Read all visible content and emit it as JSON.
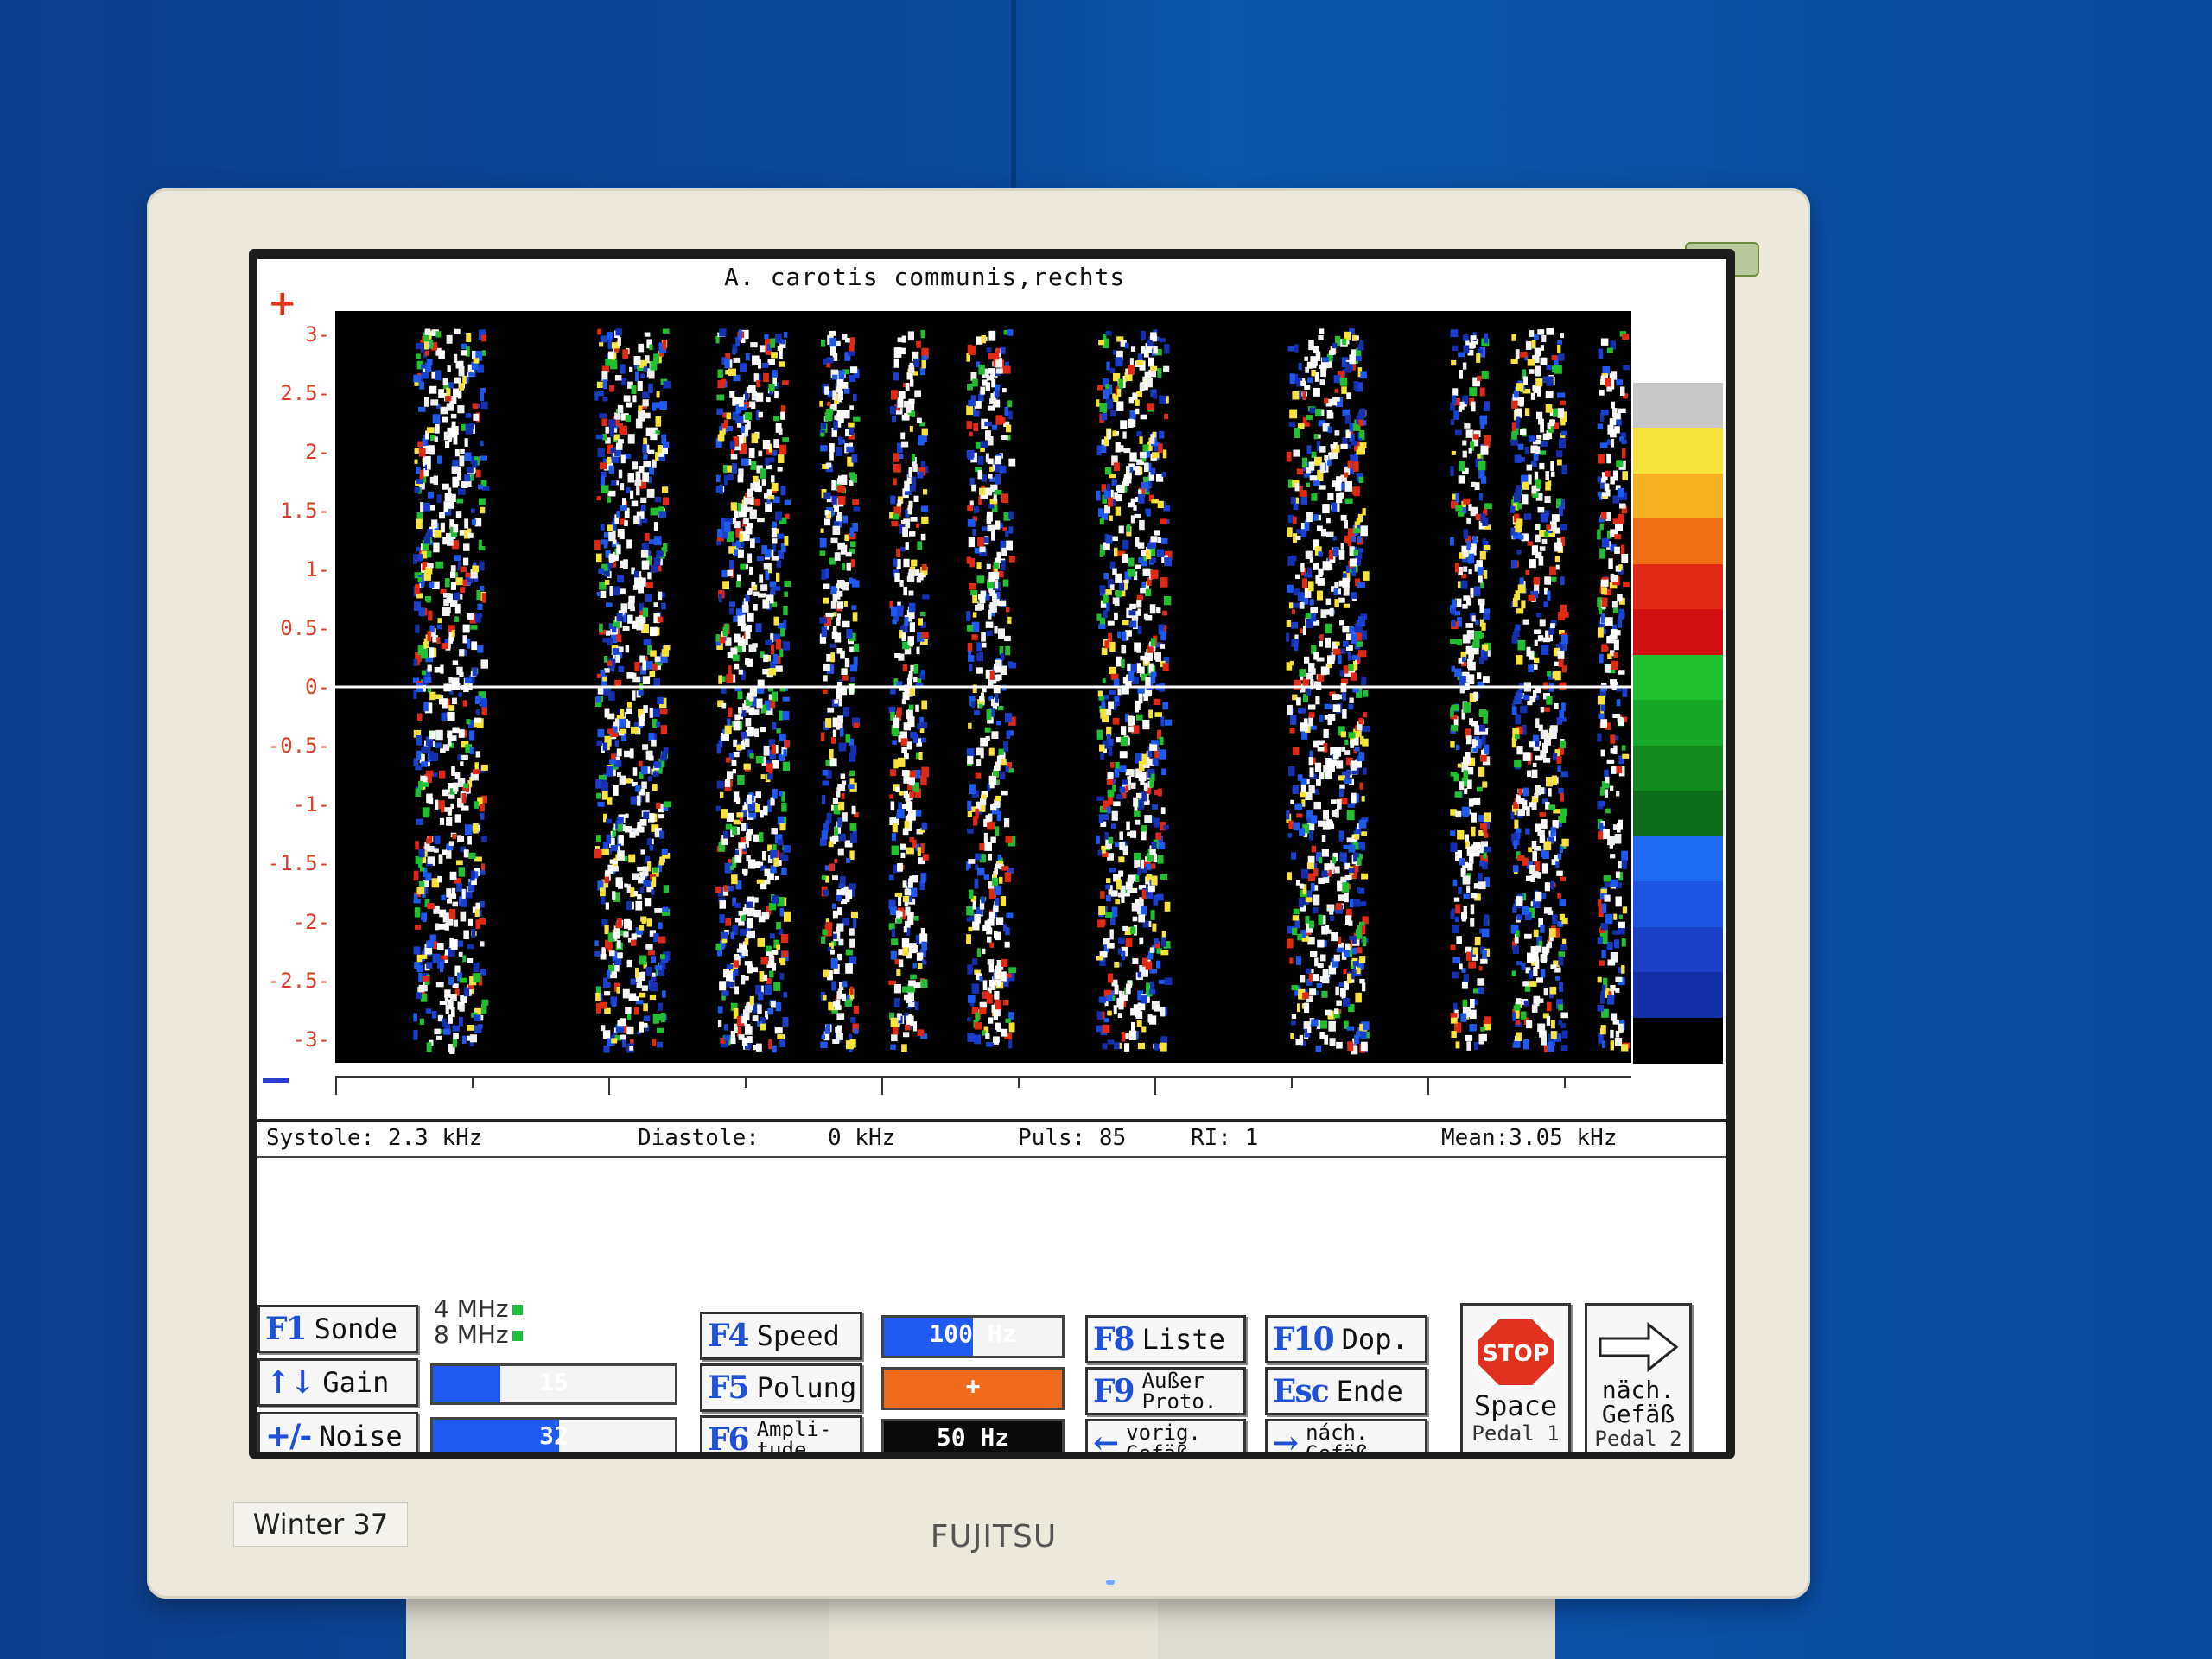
{
  "plot": {
    "title": "A. carotis communis,rechts",
    "plus_sign": "+",
    "y_ticks": [
      "3",
      "2.5",
      "2",
      "1.5",
      "1",
      "0.5",
      "0",
      "-0.5",
      "-1",
      "-1.5",
      "-2",
      "-2.5",
      "-3"
    ],
    "y_range": [
      -3.2,
      3.2
    ],
    "color_scale": [
      "#ffffff",
      "#c8c8c8",
      "#f7e33b",
      "#f5b022",
      "#f06e14",
      "#e02a14",
      "#d01010",
      "#20c030",
      "#18a828",
      "#128a1e",
      "#0c6d18",
      "#1e6af0",
      "#1c55e0",
      "#1a40c8",
      "#1430a8",
      "#000000"
    ]
  },
  "measurements": {
    "systole": "Systole: 2.3 kHz",
    "diastole_label": "Diastole:",
    "diastole_value": "0 kHz",
    "puls": "Puls: 85",
    "ri": "RI: 1",
    "mean": "Mean:3.05 kHz"
  },
  "controls": {
    "f1": {
      "key": "F1",
      "label": "Sonde"
    },
    "gain": {
      "key": "↑↓",
      "label": "Gain",
      "value": "15",
      "level_percent": 28
    },
    "noise": {
      "key": "+/-",
      "label": "Noise",
      "value": "32",
      "level_percent": 52
    },
    "probe_freqs": [
      "4 MHz",
      "8 MHz"
    ],
    "f4": {
      "key": "F4",
      "label": "Speed",
      "value": "100 Hz",
      "level_percent": 50
    },
    "f5": {
      "key": "F5",
      "label": "Polung",
      "value": "+"
    },
    "f6": {
      "key": "F6",
      "label_line1": "Ampli-",
      "label_line2": "tude",
      "value": "50 Hz"
    },
    "f8": {
      "key": "F8",
      "label": "Liste"
    },
    "f9": {
      "key": "F9",
      "label_line1": "Außer",
      "label_line2": "Proto."
    },
    "left": {
      "key": "←",
      "label_line1": "vorig.",
      "label_line2": "Gefäß"
    },
    "f10": {
      "key": "F10",
      "label": "Dop."
    },
    "esc": {
      "key": "Esc",
      "label": "Ende"
    },
    "right": {
      "key": "→",
      "label_line1": "nách.",
      "label_line2": "Gefäß"
    },
    "stop": {
      "sign": "STOP",
      "label": "Space",
      "sub": "Pedal 1"
    },
    "next": {
      "label_line1": "näch.",
      "label_line2": "Gefäß",
      "sub": "Pedal 2"
    }
  },
  "bezel": {
    "sticker": "Winter 37",
    "brand": "FUJITSU"
  }
}
